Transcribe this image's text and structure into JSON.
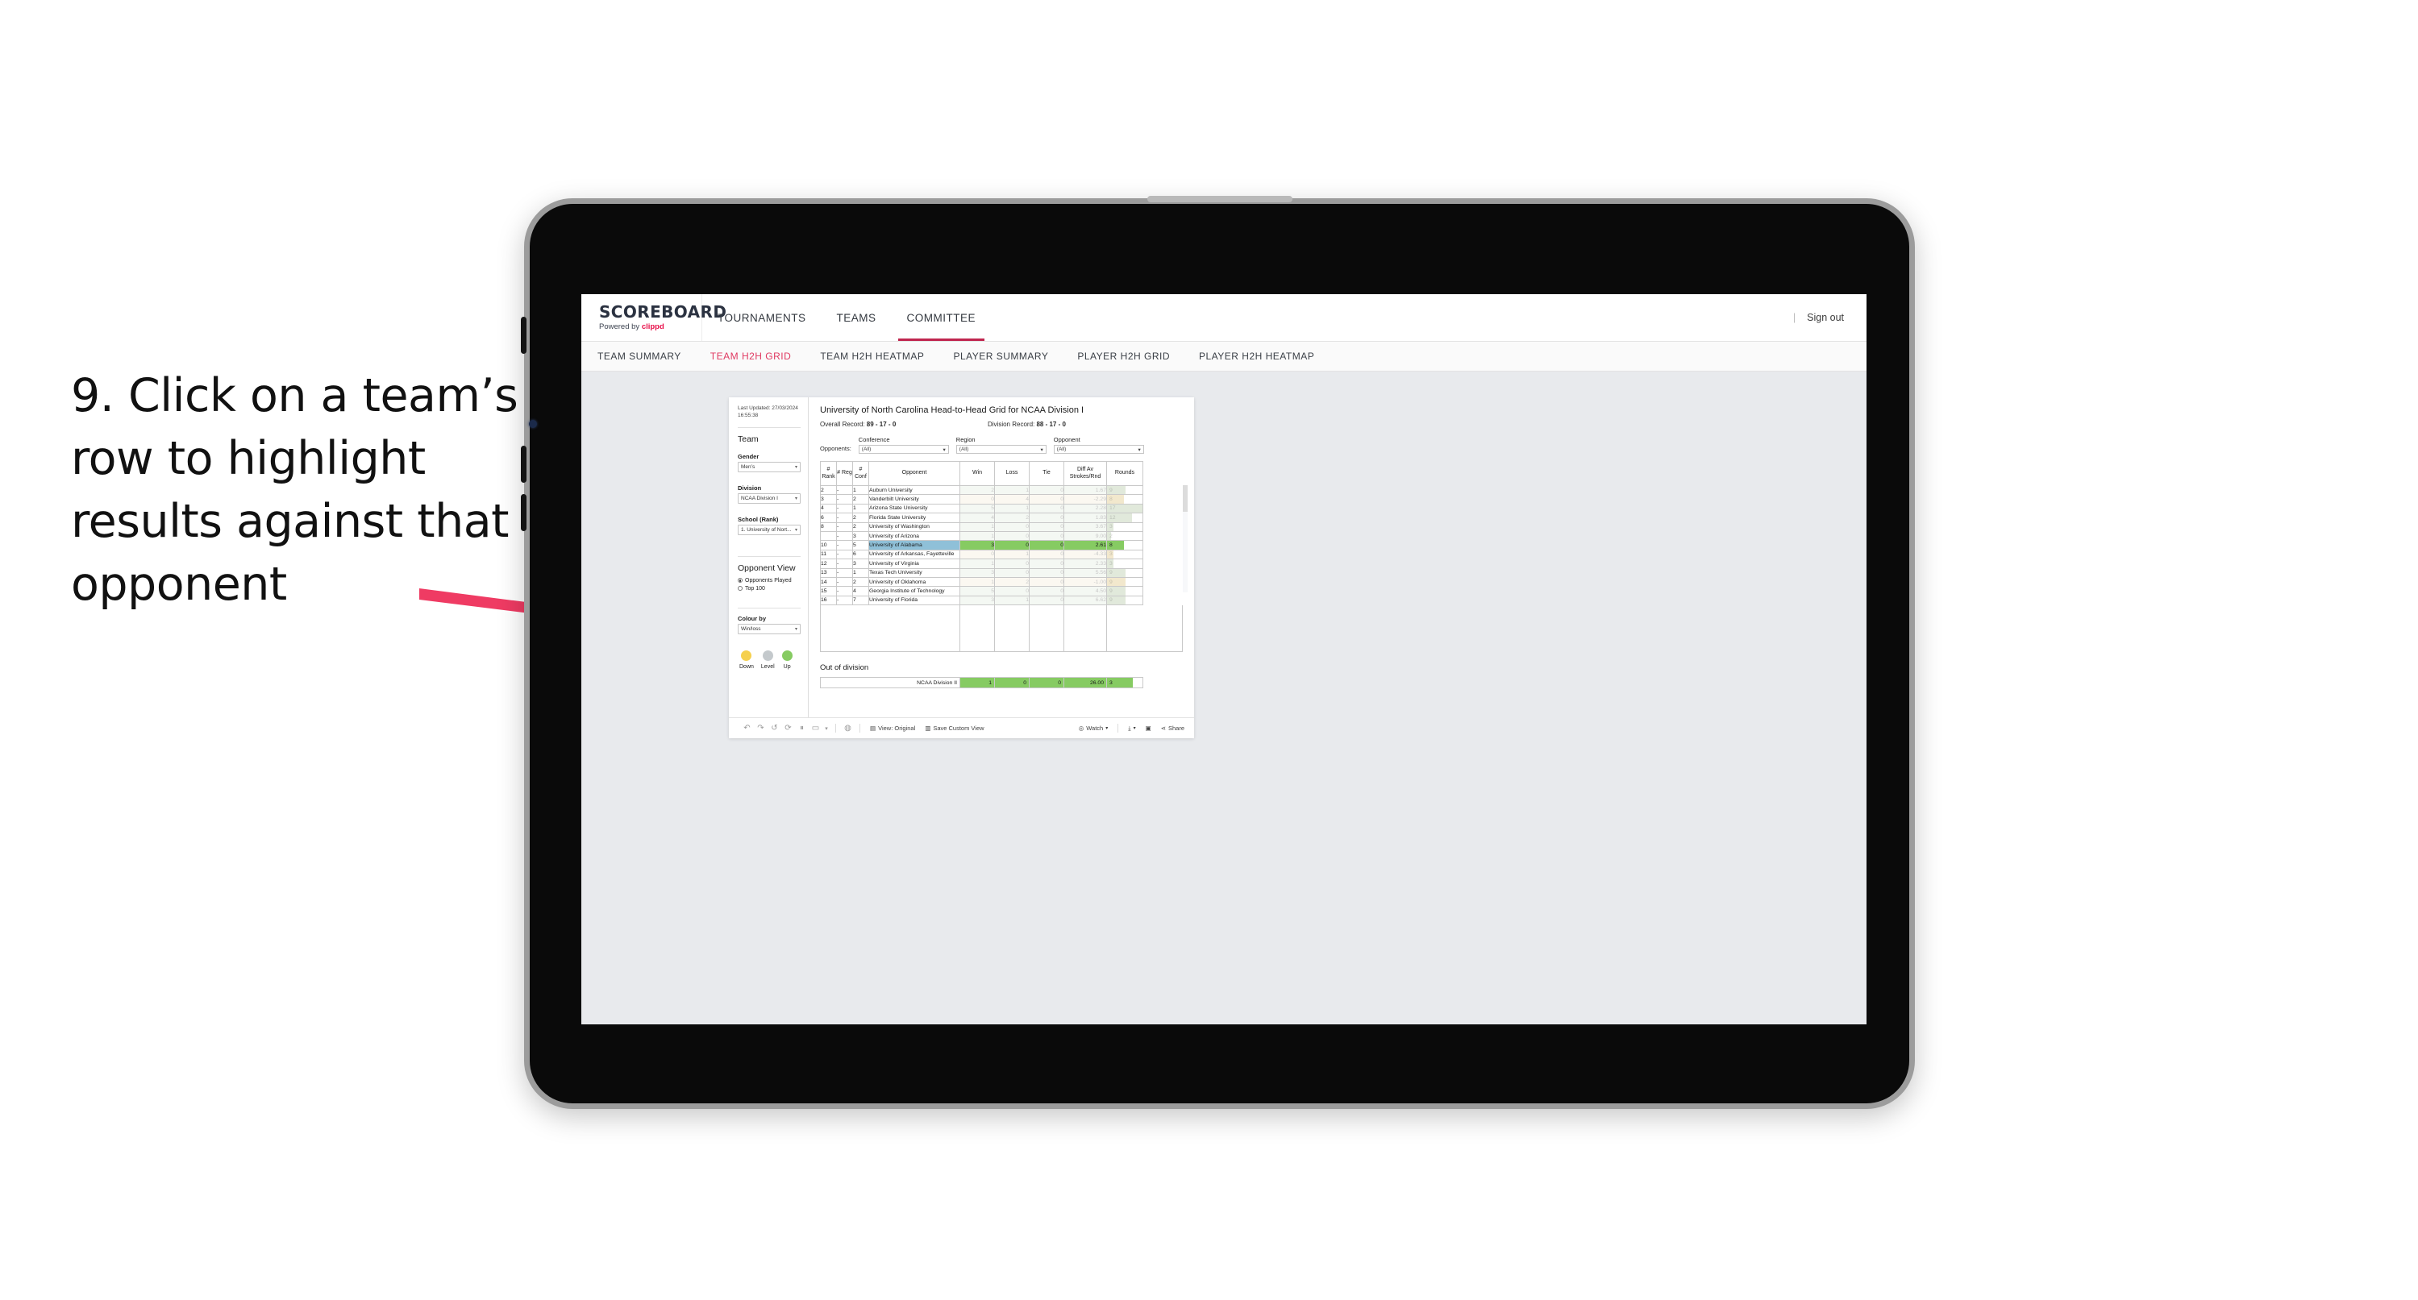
{
  "annotation": {
    "text": "9. Click on a team’s row to highlight results against that opponent",
    "arrow_color": "#ef3b63"
  },
  "topnav": {
    "brand": "SCOREBOARD",
    "powered_prefix": "Powered by ",
    "powered_brand": "clippd",
    "items": [
      {
        "label": "TOURNAMENTS",
        "active": false
      },
      {
        "label": "TEAMS",
        "active": false
      },
      {
        "label": "COMMITTEE",
        "active": true
      }
    ],
    "divider": "|",
    "sign_out": "Sign out",
    "accent": "#c0254e"
  },
  "subnav": {
    "items": [
      {
        "label": "TEAM SUMMARY",
        "active": false
      },
      {
        "label": "TEAM H2H GRID",
        "active": true
      },
      {
        "label": "TEAM H2H HEATMAP",
        "active": false
      },
      {
        "label": "PLAYER SUMMARY",
        "active": false
      },
      {
        "label": "PLAYER H2H GRID",
        "active": false
      },
      {
        "label": "PLAYER H2H HEATMAP",
        "active": false
      }
    ],
    "active_color": "#e03a62"
  },
  "sidebar": {
    "last_updated": "Last Updated: 27/03/2024 16:55:38",
    "team_heading": "Team",
    "gender_label": "Gender",
    "gender_value": "Men’s",
    "division_label": "Division",
    "division_value": "NCAA Division I",
    "school_label": "School (Rank)",
    "school_value": "1. University of Nort...",
    "opponent_view_heading": "Opponent View",
    "opponent_view_options": [
      {
        "label": "Opponents Played",
        "selected": true
      },
      {
        "label": "Top 100",
        "selected": false
      }
    ],
    "colour_by_label": "Colour by",
    "colour_by_value": "Win/loss",
    "legend": [
      {
        "label": "Down",
        "color": "#f5d04e"
      },
      {
        "label": "Level",
        "color": "#c4c9cc"
      },
      {
        "label": "Up",
        "color": "#86cb62"
      }
    ]
  },
  "viz": {
    "title": "University of North Carolina Head-to-Head Grid for NCAA Division I",
    "overall_record_label": "Overall Record: ",
    "overall_record_value": "89 - 17 - 0",
    "division_record_label": "Division Record: ",
    "division_record_value": "88 - 17 - 0",
    "opponents_label": "Opponents:",
    "filters": [
      {
        "label": "Conference",
        "value": "(All)"
      },
      {
        "label": "Region",
        "value": "(All)"
      },
      {
        "label": "Opponent",
        "value": "(All)"
      }
    ],
    "out_of_division_title": "Out of division"
  },
  "chart_data": {
    "type": "table",
    "title": "University of North Carolina Head-to-Head Grid for NCAA Division I",
    "columns": [
      "# Rank",
      "# Reg",
      "# Conf",
      "Opponent",
      "Win",
      "Loss",
      "Tie",
      "Diff Av Strokes/Rnd",
      "Rounds"
    ],
    "rounds_max": 17,
    "selected_row_index": 6,
    "rows": [
      {
        "rank": "2",
        "reg": "-",
        "conf": "1",
        "opponent": "Auburn University",
        "win": "2",
        "loss": "1",
        "tie": "0",
        "diff": "1.67",
        "rounds": "9",
        "trend": "up"
      },
      {
        "rank": "3",
        "reg": "-",
        "conf": "2",
        "opponent": "Vanderbilt University",
        "win": "0",
        "loss": "4",
        "tie": "0",
        "diff": "-2.29",
        "rounds": "8",
        "trend": "down"
      },
      {
        "rank": "4",
        "reg": "-",
        "conf": "1",
        "opponent": "Arizona State University",
        "win": "5",
        "loss": "1",
        "tie": "0",
        "diff": "2.28",
        "rounds": "17",
        "trend": "up"
      },
      {
        "rank": "6",
        "reg": "-",
        "conf": "2",
        "opponent": "Florida State University",
        "win": "4",
        "loss": "2",
        "tie": "0",
        "diff": "1.83",
        "rounds": "12",
        "trend": "up"
      },
      {
        "rank": "8",
        "reg": "-",
        "conf": "2",
        "opponent": "University of Washington",
        "win": "1",
        "loss": "0",
        "tie": "0",
        "diff": "3.67",
        "rounds": "3",
        "trend": "up"
      },
      {
        "rank": "",
        "reg": "-",
        "conf": "3",
        "opponent": "University of Arizona",
        "win": "1",
        "loss": "0",
        "tie": "0",
        "diff": "9.00",
        "rounds": "2",
        "trend": "up"
      },
      {
        "rank": "10",
        "reg": "-",
        "conf": "5",
        "opponent": "University of Alabama",
        "win": "3",
        "loss": "0",
        "tie": "0",
        "diff": "2.61",
        "rounds": "8",
        "trend": "up"
      },
      {
        "rank": "11",
        "reg": "-",
        "conf": "6",
        "opponent": "University of Arkansas, Fayetteville",
        "win": "0",
        "loss": "1",
        "tie": "0",
        "diff": "-4.33",
        "rounds": "3",
        "trend": "down"
      },
      {
        "rank": "12",
        "reg": "-",
        "conf": "3",
        "opponent": "University of Virginia",
        "win": "1",
        "loss": "0",
        "tie": "0",
        "diff": "2.33",
        "rounds": "3",
        "trend": "up"
      },
      {
        "rank": "13",
        "reg": "-",
        "conf": "1",
        "opponent": "Texas Tech University",
        "win": "3",
        "loss": "0",
        "tie": "0",
        "diff": "5.56",
        "rounds": "9",
        "trend": "up"
      },
      {
        "rank": "14",
        "reg": "-",
        "conf": "2",
        "opponent": "University of Oklahoma",
        "win": "1",
        "loss": "2",
        "tie": "0",
        "diff": "-1.00",
        "rounds": "9",
        "trend": "down"
      },
      {
        "rank": "15",
        "reg": "-",
        "conf": "4",
        "opponent": "Georgia Institute of Technology",
        "win": "5",
        "loss": "0",
        "tie": "0",
        "diff": "4.50",
        "rounds": "9",
        "trend": "up"
      },
      {
        "rank": "16",
        "reg": "-",
        "conf": "7",
        "opponent": "University of Florida",
        "win": "3",
        "loss": "1",
        "tie": "0",
        "diff": "6.62",
        "rounds": "9",
        "trend": "up"
      }
    ],
    "out_of_division": {
      "label": "NCAA Division II",
      "win": "1",
      "loss": "0",
      "tie": "0",
      "diff": "26.00",
      "rounds": "3"
    }
  },
  "toolbar": {
    "icons": [
      "undo-icon",
      "redo-icon",
      "revert-icon",
      "refresh-icon",
      "pause-icon",
      "presentation-icon",
      "caret-down-icon",
      "highlight-icon"
    ],
    "view_label": "View: Original",
    "save_custom_view_label": "Save Custom View",
    "watch_label": "Watch",
    "share_label": "Share"
  }
}
